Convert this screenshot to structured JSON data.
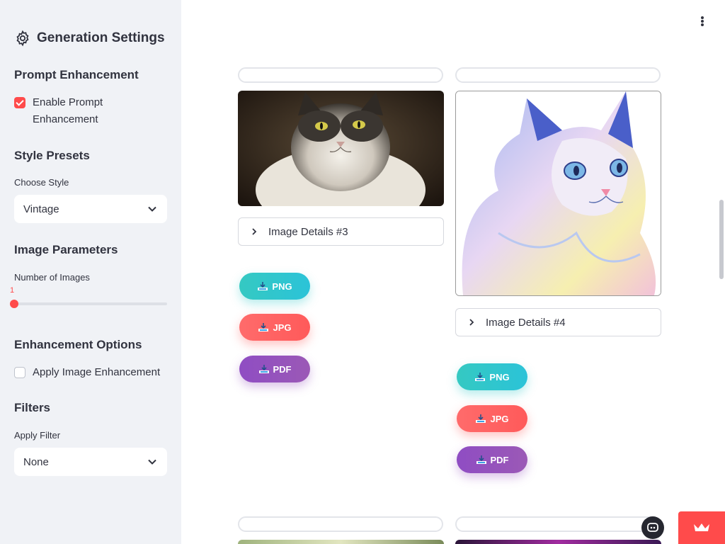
{
  "sidebar": {
    "title": "Generation Settings",
    "prompt_section": "Prompt Enhancement",
    "enable_prompt": {
      "label": "Enable Prompt Enhancement",
      "checked": true
    },
    "style_section": "Style Presets",
    "choose_style_label": "Choose Style",
    "choose_style_value": "Vintage",
    "image_params_section": "Image Parameters",
    "num_images_label": "Number of Images",
    "num_images_value": "1",
    "enhancement_section": "Enhancement Options",
    "apply_enhancement": {
      "label": "Apply Image Enhancement",
      "checked": false
    },
    "filters_section": "Filters",
    "apply_filter_label": "Apply Filter",
    "apply_filter_value": "None"
  },
  "images": [
    {
      "details_label": "Image Details #3",
      "png": "PNG",
      "jpg": "JPG",
      "pdf": "PDF"
    },
    {
      "details_label": "Image Details #4",
      "png": "PNG",
      "jpg": "JPG",
      "pdf": "PDF"
    }
  ],
  "colors": {
    "accent": "#ff4b4b",
    "png": "#2bc3d8",
    "jpg": "#ff5a5a",
    "pdf": "#9b59b6",
    "sidebar_bg": "#f0f2f6"
  }
}
